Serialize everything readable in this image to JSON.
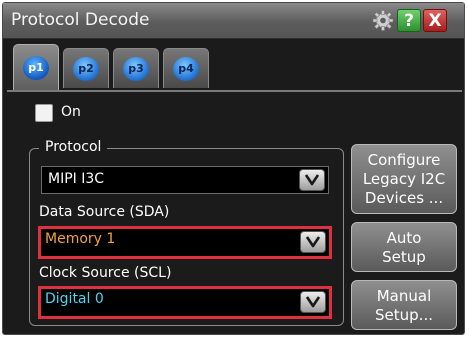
{
  "window": {
    "title": "Protocol Decode",
    "title_buttons": [
      {
        "name": "gear-icon"
      },
      {
        "name": "help-icon",
        "glyph": "?"
      },
      {
        "name": "close-icon",
        "glyph": "X"
      }
    ]
  },
  "tabs": [
    {
      "label": "p1",
      "active": true
    },
    {
      "label": "p2",
      "active": false
    },
    {
      "label": "p3",
      "active": false
    },
    {
      "label": "p4",
      "active": false
    }
  ],
  "on_checkbox": {
    "label": "On",
    "checked": false
  },
  "protocol_group": {
    "title": "Protocol",
    "protocol_value": "MIPI I3C",
    "data_source_label": "Data Source (SDA)",
    "data_source_value": "Memory 1",
    "clock_source_label": "Clock Source (SCL)",
    "clock_source_value": "Digital 0"
  },
  "side_buttons": {
    "configure": [
      "Configure",
      "Legacy I2C",
      "Devices ..."
    ],
    "auto": [
      "Auto",
      "Setup"
    ],
    "manual": [
      "Manual",
      "Setup..."
    ]
  },
  "colors": {
    "highlight_border": "#e03040",
    "memory_text": "#f0a33c",
    "digital_text": "#46d8f2",
    "panel_bg": "#1b1b1b"
  }
}
